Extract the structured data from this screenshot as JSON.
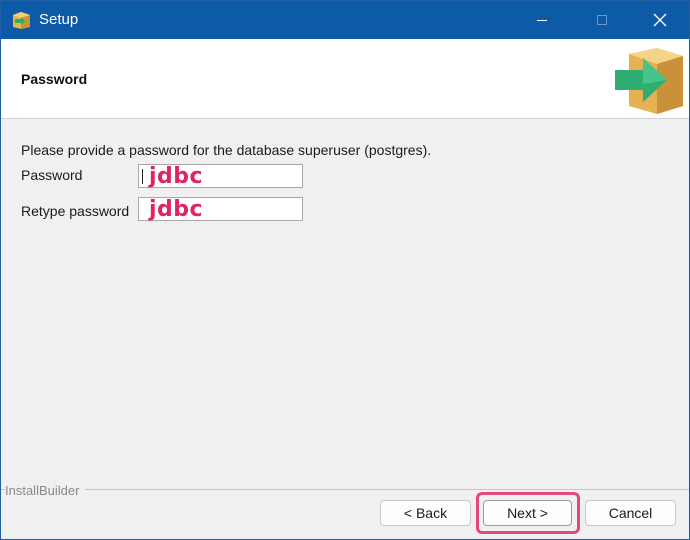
{
  "window": {
    "title": "Setup",
    "icons": {
      "app": "installer-box-icon",
      "minimize": "minimize-icon",
      "maximize": "maximize-icon",
      "close": "close-icon"
    }
  },
  "header": {
    "title": "Password",
    "icon": "installer-arrow-box-icon"
  },
  "form": {
    "description": "Please provide a password for the database superuser (postgres).",
    "password_label": "Password",
    "password_value": "jdbc",
    "retype_label": "Retype password",
    "retype_value": "jdbc"
  },
  "footer": {
    "brand": "InstallBuilder",
    "back_label": "< Back",
    "next_label": "Next >",
    "cancel_label": "Cancel"
  },
  "colors": {
    "titlebar": "#0d5aa7",
    "annotation": "#e0245e",
    "highlight": "#e24a7b"
  }
}
